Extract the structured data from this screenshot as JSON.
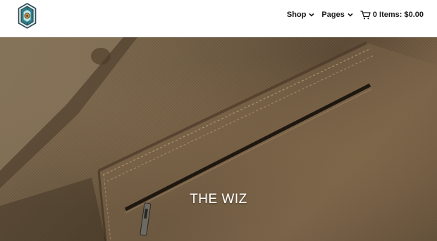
{
  "header": {
    "logo_icon": "hexagon-emblem-icon",
    "nav": [
      {
        "label": "Shop",
        "icon": "chevron-down-icon"
      },
      {
        "label": "Pages",
        "icon": "chevron-down-icon"
      }
    ],
    "cart": {
      "icon": "shopping-cart-icon",
      "label": "0 Items: $0.00"
    }
  },
  "hero": {
    "title": "THE WIZ",
    "image": "canvas-jacket-pocket-photo"
  },
  "colors": {
    "header_bg": "#ffffff",
    "nav_text": "#1a1a1a",
    "hero_title": "#ffffff",
    "logo_teal": "#2f7f86",
    "logo_orange": "#e08a2a"
  }
}
